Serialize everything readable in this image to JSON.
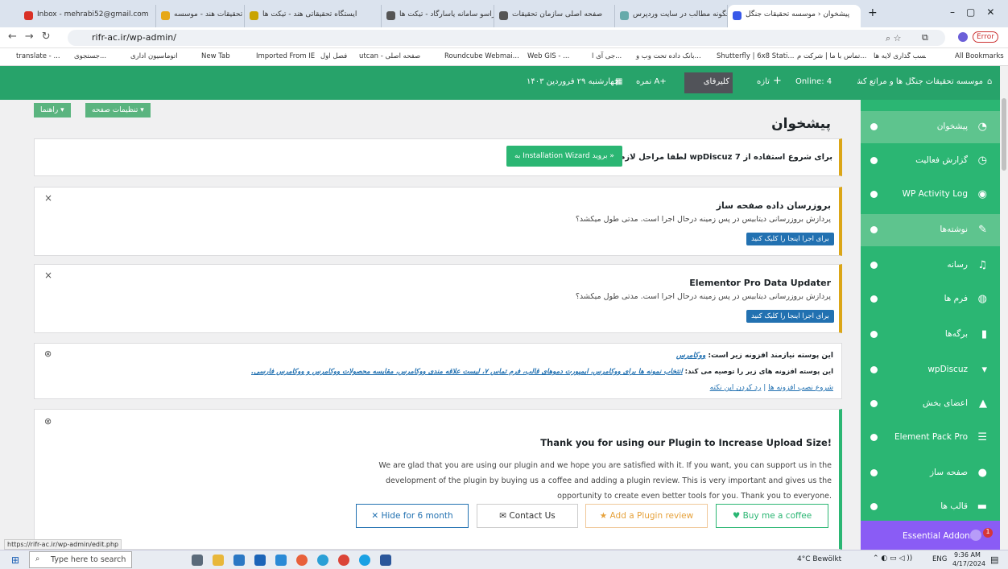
{
  "tabs": [
    {
      "title": "Inbox - mehrabi52@gmail.com"
    },
    {
      "title": "ایستگاه تحقیقات هند - موسسه"
    },
    {
      "title": "ایستگاه تحقیقاتی هند - تیکت ها"
    },
    {
      "title": "فراسو سامانه یاسارگاد - تیکت ها"
    },
    {
      "title": "صفحه اصلی سازمان تحقیقات"
    },
    {
      "title": "چگونه مطالب در سایت وردپرس"
    },
    {
      "title": "پیشخوان ‹ موسسه تحقیقات جنگل"
    }
  ],
  "url": "rifr-ac.ir/wp-admin/",
  "browser": {
    "error": "Error",
    "all_bookmarks": "All Bookmarks"
  },
  "bookmarks": [
    "translate - ...",
    "جستجوی...",
    "اتوماسیون اداری",
    "New Tab",
    "Imported From IE",
    "فصل اول",
    "utcan - صفحه اصلی",
    "Roundcube Webmai...",
    "Web GIS - ...",
    "جی آی ا...",
    "بانک داده تحت وب و...",
    "Shutterfly | 6x8 Stati...",
    "تماس با ما | شرکت م...",
    "برچسب گذاری لایه ها..."
  ],
  "adminbar": {
    "site": "موسسه تحقیقات جنگل ها و مراتع کشور",
    "online": "Online: 4",
    "new": "تازه",
    "colorfy": "کلیرفای",
    "score": "نمره A+",
    "date": "چهارشنبه ۲۹ فروردین ۱۴۰۳"
  },
  "screen_options": "تنظیمات صفحه ▾",
  "help": "راهنما ▾",
  "page_title": "پیشخوان",
  "sidebar": [
    {
      "label": "پیشخوان",
      "icon": "dashboard-icon"
    },
    {
      "label": "گزارش فعالیت",
      "icon": "history-icon"
    },
    {
      "label": "WP Activity Log",
      "icon": "eye-icon"
    },
    {
      "label": "نوشته‌ها",
      "icon": "pin-icon"
    },
    {
      "label": "رسانه",
      "icon": "media-icon"
    },
    {
      "label": "فرم ها",
      "icon": "form-icon"
    },
    {
      "label": "برگه‌ها",
      "icon": "page-icon"
    },
    {
      "label": "wpDiscuz",
      "icon": "comment-icon"
    },
    {
      "label": "اعضای بخش",
      "icon": "users-icon"
    },
    {
      "label": "Element Pack Pro",
      "icon": "element-icon"
    },
    {
      "label": "صفحه ساز",
      "icon": "elementor-icon"
    },
    {
      "label": "قالب ها",
      "icon": "folder-icon"
    },
    {
      "label": "Essential Addons",
      "icon": "ea-icon",
      "badge": "1"
    }
  ],
  "notice_wpdiscuz": {
    "text": "برای شروع استفاده از wpDiscuz 7 لطفا مراحل لازم را انجام دهید",
    "button": "به Installation Wizard بروید »"
  },
  "notice_updater": {
    "title": "بروزرسان داده صفحه ساز",
    "desc": "پردازش بروزرسانی دیتابیس در پس زمینه درحال اجرا است. مدتی طول میکشد؟",
    "button": "برای اجرا اینجا را کلیک کنید"
  },
  "notice_elementor": {
    "title": "Elementor Pro Data Updater",
    "desc": "پردازش بروزرسانی دیتابیس در پس زمینه درحال اجرا است. مدتی طول میکشد؟",
    "button": "برای اجرا اینجا را کلیک کنید"
  },
  "notice_theme": {
    "line1_prefix": "این پوسته نیازمند افزونه زیر است:",
    "line1_link": "ووکامرس",
    "line2_prefix": "این پوسته افزونه های زیر را توصیه می کند:",
    "line2_links": "انتخاب نمونه ها برای ووکامرس، ایمپورت دموهای قالب، فرم تماس ۷، لیست علاقه مندی ووکامرس، مقایسه محصولات ووکامرس و ووکامرس فارسی.",
    "install_link": "شروع نصب افزونه ها",
    "dismiss_link": "رد کردن این نکته"
  },
  "notice_upload": {
    "title": "Thank you for using our Plugin to Increase Upload Size!",
    "p1": "We are glad that you are using our plugin and we hope you are satisfied with it. If you want, you can support us in the",
    "p2": "development of the plugin by buying us a coffee and adding a plugin review. This is very important and gives us the",
    "p3": "opportunity to create even better tools for you. Thank you to everyone.",
    "hide": "Hide for 6 month",
    "contact": "Contact Us",
    "review": "Add a Plugin review",
    "coffee": "Buy me a coffee"
  },
  "statusbar": "https://rifr-ac.ir/wp-admin/edit.php",
  "taskbar": {
    "search": "Type here to search",
    "weather": "4°C Bewölkt",
    "lang": "ENG",
    "time": "9:36 AM",
    "date": "4/17/2024"
  },
  "colors": {
    "wpgreen": "#27a36a",
    "sidebar": "#2bb673",
    "current": "#5ec48e",
    "accent": "#2271b1",
    "purple": "#8a5cf5"
  }
}
